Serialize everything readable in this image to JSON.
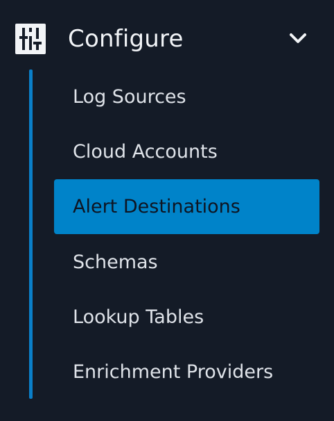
{
  "section": {
    "title": "Configure",
    "icon": "sliders-icon",
    "expand_icon": "chevron-down-icon"
  },
  "items": [
    {
      "label": "Log Sources",
      "active": false
    },
    {
      "label": "Cloud Accounts",
      "active": false
    },
    {
      "label": "Alert Destinations",
      "active": true
    },
    {
      "label": "Schemas",
      "active": false
    },
    {
      "label": "Lookup Tables",
      "active": false
    },
    {
      "label": "Enrichment Providers",
      "active": false
    }
  ],
  "colors": {
    "background": "#141b27",
    "accent": "#0083c9",
    "text": "#dfe3e9"
  }
}
